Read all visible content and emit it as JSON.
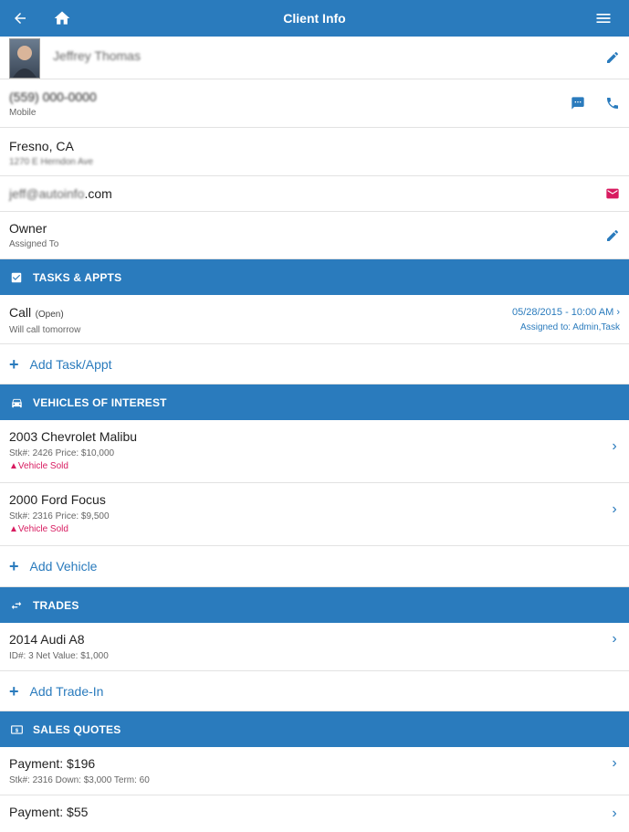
{
  "header": {
    "title": "Client Info",
    "back_icon": "back-arrow-icon",
    "home_icon": "home-icon",
    "menu_icon": "hamburger-menu-icon"
  },
  "client": {
    "name": "Jeffrey Thomas",
    "phone": "(559) 000-0000",
    "phone_label": "Mobile",
    "city": "Fresno, CA",
    "address": "1270 E Herndon Ave",
    "email_user": "jeff@autoinfo",
    "email_domain": ".com",
    "owner": "Owner",
    "owner_label": "Assigned To"
  },
  "tasks": {
    "header": "TASKS & APPTS",
    "item_title": "Call",
    "item_status": "(Open)",
    "item_note": "Will call tomorrow",
    "item_datetime": "05/28/2015 - 10:00 AM",
    "item_assigned": "Assigned to: Admin,Task",
    "add_label": "Add Task/Appt"
  },
  "vehicles": {
    "header": "VEHICLES OF INTEREST",
    "items": [
      {
        "title": "2003 Chevrolet Malibu",
        "meta": "Stk#: 2426   Price: $10,000",
        "status": "Vehicle Sold"
      },
      {
        "title": "2000 Ford Focus",
        "meta": "Stk#: 2316   Price: $9,500",
        "status": "Vehicle Sold"
      }
    ],
    "add_label": "Add Vehicle"
  },
  "trades": {
    "header": "TRADES",
    "items": [
      {
        "title": "2014 Audi A8",
        "meta": "ID#: 3   Net Value: $1,000"
      }
    ],
    "add_label": "Add Trade-In"
  },
  "quotes": {
    "header": "SALES QUOTES",
    "items": [
      {
        "title": "Payment: $196",
        "meta": "Stk#: 2316   Down: $3,000   Term: 60"
      },
      {
        "title": "Payment: $55",
        "meta": ""
      }
    ]
  },
  "colors": {
    "primary": "#2a7bbd",
    "alert": "#d81b60"
  }
}
